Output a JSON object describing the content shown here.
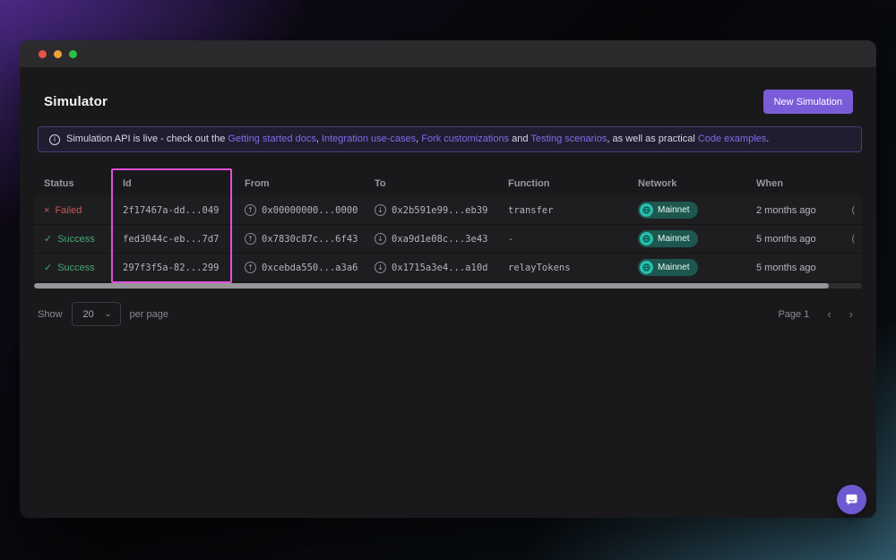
{
  "window": {
    "traffic_lights": {
      "close": "close",
      "minimize": "minimize",
      "zoom": "zoom"
    }
  },
  "page": {
    "title": "Simulator",
    "new_simulation_button": "New Simulation"
  },
  "banner": {
    "info_icon": "i",
    "t1": "Simulation API is live - check out the ",
    "l1": "Getting started docs",
    "t2": ", ",
    "l2": "Integration use-cases",
    "t3": ", ",
    "l3": "Fork customizations",
    "t4": " and ",
    "l4": "Testing scenarios",
    "t5": ", as well as practical ",
    "l5": "Code examples",
    "t6": "."
  },
  "table": {
    "columns": [
      "Status",
      "Id",
      "From",
      "To",
      "Function",
      "Network",
      "When"
    ],
    "from_icon": "↑",
    "to_icon": "↓",
    "rows": [
      {
        "status": "Failed",
        "status_icon": "×",
        "status_color": "#cf5353",
        "id": "2f17467a-dd...049",
        "from": "0x00000000...0000",
        "to": "0x2b591e99...eb39",
        "function": "transfer",
        "network": "Mainnet",
        "when": "2 months ago",
        "overflow": "("
      },
      {
        "status": "Success",
        "status_icon": "✓",
        "status_color": "#43a874",
        "id": "fed3044c-eb...7d7",
        "from": "0x7830c87c...6f43",
        "to": "0xa9d1e08c...3e43",
        "function": "-",
        "network": "Mainnet",
        "when": "5 months ago",
        "overflow": "("
      },
      {
        "status": "Success",
        "status_icon": "✓",
        "status_color": "#43a874",
        "id": "297f3f5a-82...299",
        "from": "0xcebda550...a3a6",
        "to": "0x1715a3e4...a10d",
        "function": "relayTokens",
        "network": "Mainnet",
        "when": "5 months ago",
        "overflow": ""
      }
    ]
  },
  "pagination": {
    "show_label": "Show",
    "page_size": "20",
    "select_chevron": "⌄",
    "per_page_label": "per page",
    "page_label": "Page 1",
    "prev_icon": "‹",
    "next_icon": "›"
  },
  "colors": {
    "accent_purple": "#7a5cd9",
    "annotation_magenta": "#e24fd8",
    "failed_red": "#cf5353",
    "success_green": "#43a874",
    "badge_teal_dark": "#1d574f",
    "badge_teal_bright": "#27c0ac",
    "link_purple": "#7d6ee4"
  }
}
